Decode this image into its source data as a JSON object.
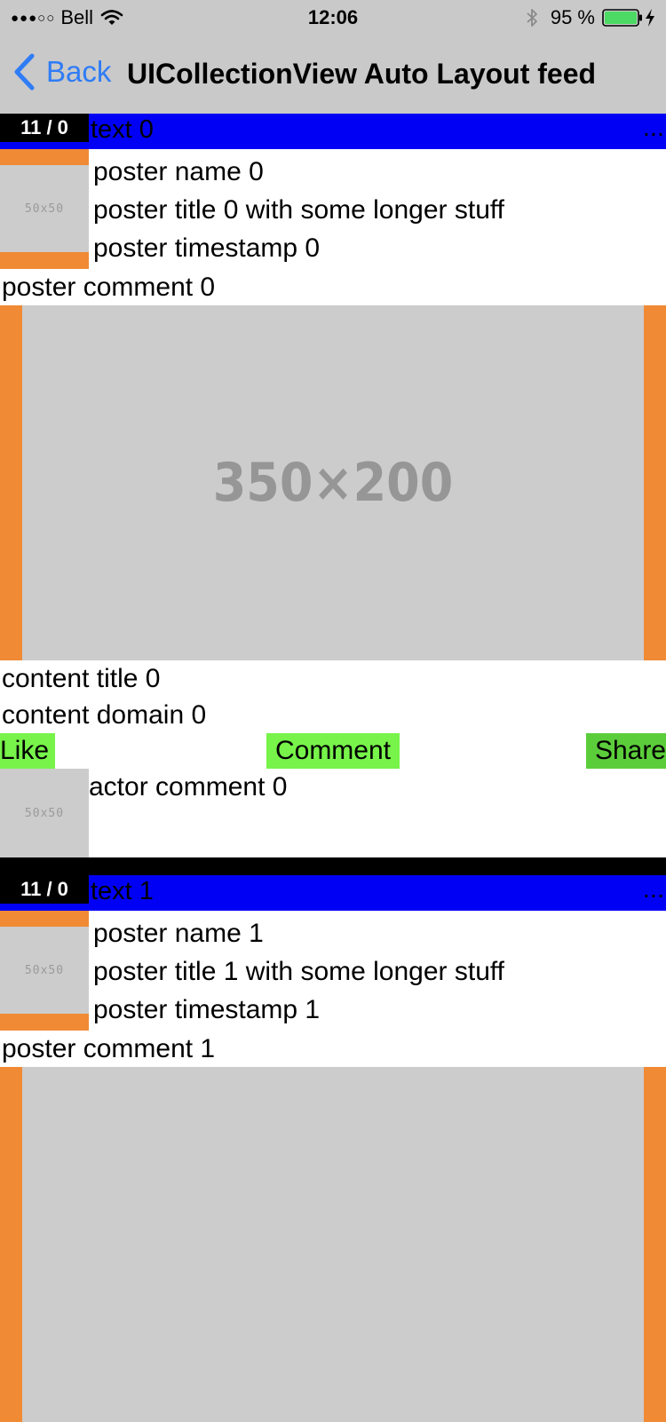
{
  "status_bar": {
    "signal": "●●●○○",
    "carrier": "Bell",
    "time": "12:06",
    "battery_percent": "95 %"
  },
  "nav": {
    "back_label": "Back",
    "title": "UICollectionView Auto Layout feed"
  },
  "colors": {
    "header_blue": "#0000f5",
    "frame_orange": "#f08a35",
    "placeholder_gray": "#cccccc",
    "button_green": "#77f34a",
    "share_green": "#5ccd3a",
    "link_blue": "#2f7cf6"
  },
  "feed": {
    "items": [
      {
        "counter": "11 / 0",
        "header_text": "text 0",
        "more": "...",
        "avatar_placeholder": "50x50",
        "poster_name": "poster name 0",
        "poster_title": "poster title 0 with some longer stuff",
        "poster_timestamp": "poster timestamp 0",
        "poster_comment": "poster comment 0",
        "image_placeholder": "350×200",
        "content_title": "content title 0",
        "content_domain": "content domain 0",
        "like": "Like",
        "comment": "Comment",
        "share": "Share",
        "actor_placeholder": "50x50",
        "actor_comment": "actor comment 0"
      },
      {
        "counter": "11 / 0",
        "header_text": "text 1",
        "more": "...",
        "avatar_placeholder": "50x50",
        "poster_name": "poster name 1",
        "poster_title": "poster title 1 with some longer stuff",
        "poster_timestamp": "poster timestamp 1",
        "poster_comment": "poster comment 1"
      }
    ]
  }
}
